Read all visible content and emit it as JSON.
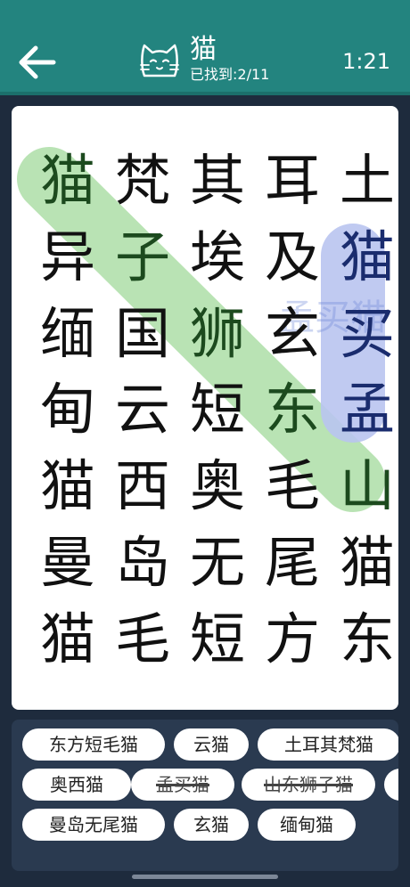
{
  "header": {
    "title": "猫",
    "progress_label": "已找到:",
    "progress_value": "2/11",
    "timer": "1:21",
    "icons": {
      "back": "back-arrow-icon",
      "category": "cat-face-icon"
    }
  },
  "grid": {
    "rows": [
      [
        "猫",
        "梵",
        "其",
        "耳",
        "土"
      ],
      [
        "异",
        "子",
        "埃",
        "及",
        "猫"
      ],
      [
        "缅",
        "国",
        "狮",
        "玄",
        "买"
      ],
      [
        "甸",
        "云",
        "短",
        "东",
        "孟"
      ],
      [
        "猫",
        "西",
        "奥",
        "毛",
        "山"
      ],
      [
        "曼",
        "岛",
        "无",
        "尾",
        "猫"
      ],
      [
        "猫",
        "毛",
        "短",
        "方",
        "东"
      ]
    ],
    "highlight_colors": {
      "green": "#b9e3b4",
      "blue": "#b9c4ef"
    },
    "ghost_text": "孟买猫"
  },
  "words": [
    {
      "text": "东方短毛猫",
      "found": false
    },
    {
      "text": "云猫",
      "found": false
    },
    {
      "text": "土耳其梵猫",
      "found": false
    },
    {
      "text": "奥西猫",
      "found": false
    },
    {
      "text": "孟买猫",
      "found": true
    },
    {
      "text": "山东狮子猫",
      "found": true
    },
    {
      "text": "",
      "found": false
    },
    {
      "text": "曼岛无尾猫",
      "found": false
    },
    {
      "text": "玄猫",
      "found": false
    },
    {
      "text": "缅甸猫",
      "found": false
    }
  ]
}
